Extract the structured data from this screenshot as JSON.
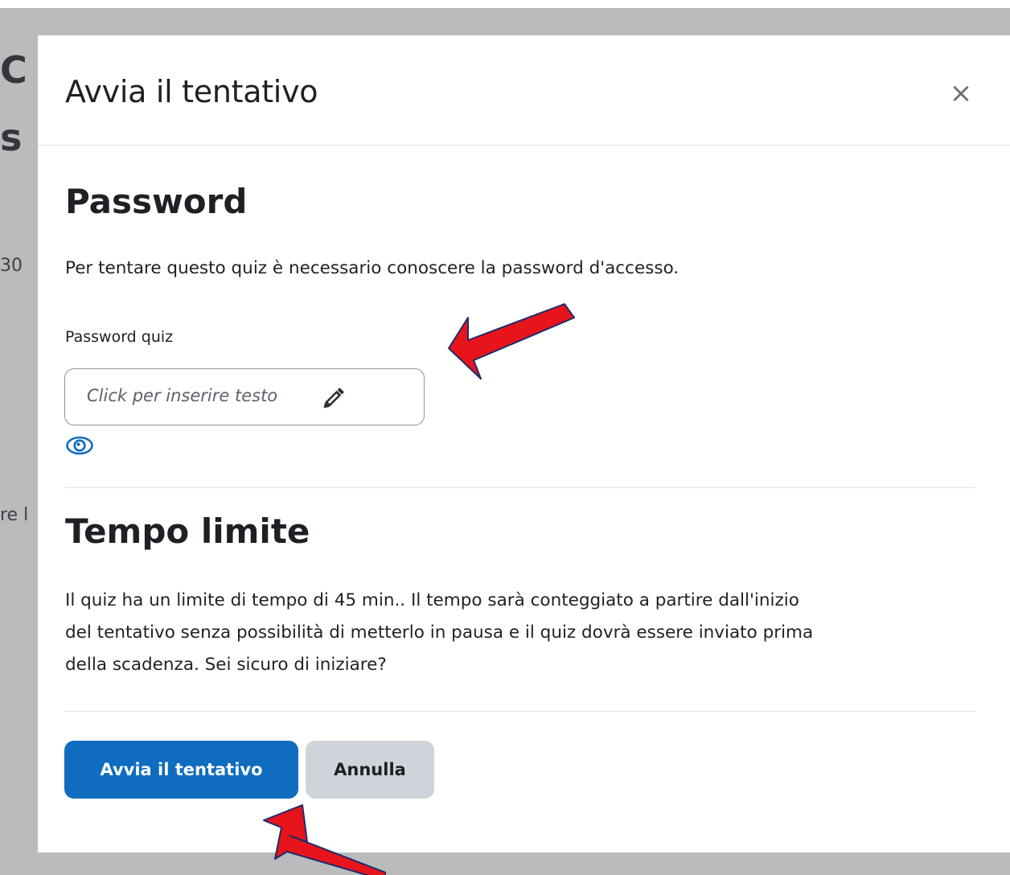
{
  "background": {
    "fragments": [
      "C",
      "s",
      "30",
      "re l",
      "l"
    ]
  },
  "modal": {
    "title": "Avvia il tentativo",
    "close_label": "×"
  },
  "password_section": {
    "heading": "Password",
    "description": "Per tentare questo quiz è necessario conoscere la password d'accesso.",
    "field_label": "Password quiz",
    "placeholder": "Click per inserire testo"
  },
  "time_section": {
    "heading": "Tempo limite",
    "lines": [
      "Il quiz ha un limite di tempo di 45 min.. Il tempo sarà conteggiato a partire dall'inizio",
      "del tentativo senza possibilità di metterlo in pausa e il quiz dovrà essere inviato prima",
      "della scadenza. Sei sicuro di iniziare?"
    ]
  },
  "footer": {
    "start_label": "Avvia il tentativo",
    "cancel_label": "Annulla"
  },
  "colors": {
    "primary": "#0f6cbf",
    "secondary": "#ced4da",
    "annotation_arrow": "#e8141c",
    "backdrop": "#b9bbbd"
  }
}
